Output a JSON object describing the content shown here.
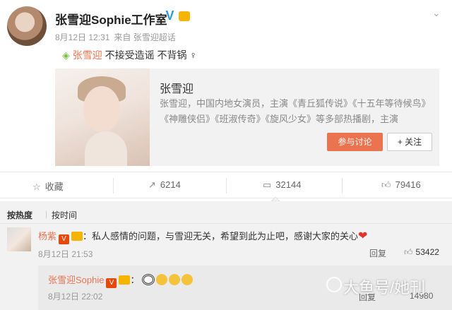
{
  "author": {
    "name": "张雪迎Sophie工作室",
    "verified_icon": "verified-v-icon",
    "badge_icon": "crown-icon"
  },
  "meta": {
    "time": "8月12日 12:31",
    "source": "来自 张雪迎超话"
  },
  "post": {
    "topic_icon": "diamond-icon",
    "topic": "张雪迎",
    "text": "不接受造谣 不背锅",
    "gender_icon": "female-icon"
  },
  "card": {
    "title": "张雪迎",
    "description": "张雪迎，中国内地女演员，主演《青丘狐传说》《十五年等待候鸟》《神雕侠侣》《班淑传奇》《旋风少女》等多部热播剧，主演",
    "join_label": "参与讨论",
    "follow_label": "+ 关注"
  },
  "actions": {
    "favorite": {
      "label": "收藏",
      "icon": "star-icon"
    },
    "repost": {
      "count": "6214",
      "icon": "repost-icon"
    },
    "comment": {
      "count": "32144",
      "icon": "comment-icon"
    },
    "like": {
      "count": "79416",
      "icon": "thumb-up-icon"
    }
  },
  "sort": {
    "hot": "按热度",
    "separator": "|",
    "time": "按时间"
  },
  "comments": [
    {
      "name": "杨紫",
      "text": "：私人感情的问题，与雪迎无关，希望到此为止吧，感谢大家的关心",
      "time": "8月12日 21:53",
      "reply_label": "回复",
      "likes": "53422"
    },
    {
      "name": "张雪迎Sophie",
      "text": "：",
      "time": "8月12日 22:02",
      "reply_label": "回复",
      "likes": "14980"
    }
  ],
  "watermark": "大鱼号/她刊",
  "colors": {
    "accent": "#eb7350",
    "verified": "#2a9be0",
    "like_heart": "#e0352b"
  }
}
